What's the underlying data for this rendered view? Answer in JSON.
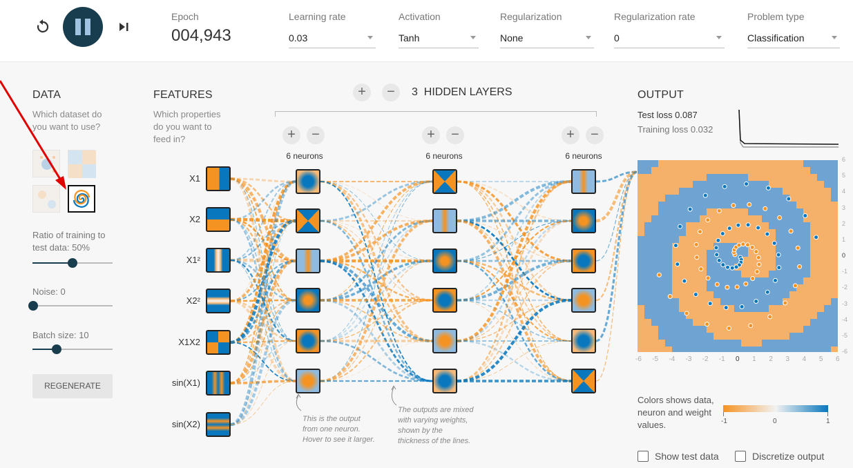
{
  "controls": {
    "reset_icon": "reset-icon",
    "play_pause_icon": "pause-icon",
    "step_icon": "step-icon"
  },
  "epoch": {
    "label": "Epoch",
    "value": "004,943"
  },
  "dropdowns": [
    {
      "label": "Learning rate",
      "value": "0.03"
    },
    {
      "label": "Activation",
      "value": "Tanh"
    },
    {
      "label": "Regularization",
      "value": "None"
    },
    {
      "label": "Regularization rate",
      "value": "0"
    },
    {
      "label": "Problem type",
      "value": "Classification"
    }
  ],
  "data_panel": {
    "title": "DATA",
    "question": "Which dataset do you want to use?",
    "ratio_label": "Ratio of training to test data:  50%",
    "ratio_value": 0.5,
    "noise_label": "Noise:  0",
    "noise_value": 0,
    "batch_label": "Batch size:  10",
    "batch_value": 0.3,
    "regenerate_label": "REGENERATE"
  },
  "features_panel": {
    "title": "FEATURES",
    "question": "Which properties do you want to feed in?",
    "features": [
      "X1",
      "X2",
      "X1²",
      "X2²",
      "X1X2",
      "sin(X1)",
      "sin(X2)"
    ]
  },
  "hidden": {
    "title": "3  HIDDEN LAYERS",
    "layers": [
      {
        "neurons_label": "6 neurons"
      },
      {
        "neurons_label": "6 neurons"
      },
      {
        "neurons_label": "6 neurons"
      }
    ],
    "note1": "This is the output from one neuron. Hover to see it larger.",
    "note2": "The outputs are mixed with varying weights, shown by the thickness of the lines."
  },
  "output_panel": {
    "title": "OUTPUT",
    "test_loss": "Test loss 0.087",
    "training_loss": "Training loss 0.032",
    "y_ticks": [
      "6",
      "5",
      "4",
      "3",
      "2",
      "1",
      "0",
      "-1",
      "-2",
      "-3",
      "-4",
      "-5",
      "-6"
    ],
    "x_ticks": [
      "-6",
      "-5",
      "-4",
      "-3",
      "-2",
      "-1",
      "0",
      "1",
      "2",
      "3",
      "4",
      "5",
      "6"
    ],
    "colors_text": "Colors shows data, neuron and weight values.",
    "scale_labels": [
      "-1",
      "0",
      "1"
    ],
    "show_test": "Show test data",
    "discretize": "Discretize output"
  },
  "colors": {
    "orange": "#f59322",
    "blue": "#0877bd",
    "dark": "#183d4e"
  }
}
